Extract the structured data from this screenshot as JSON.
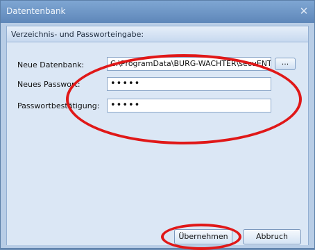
{
  "window": {
    "title": "Datentenbank"
  },
  "group": {
    "title": "Verzeichnis- und Passworteingabe:"
  },
  "fields": {
    "database_label": "Neue Datenbank:",
    "database_value": "C:\\ProgramData\\BURG-WACHTER\\secuENT",
    "browse_label": "...",
    "password_label": "Neues Passwort:",
    "password_value": "•••••",
    "confirm_label": "Passwortbestätigung:",
    "confirm_value": "•••••"
  },
  "buttons": {
    "apply": "Übernehmen",
    "cancel": "Abbruch"
  },
  "annotation": {
    "color": "#e01818"
  }
}
